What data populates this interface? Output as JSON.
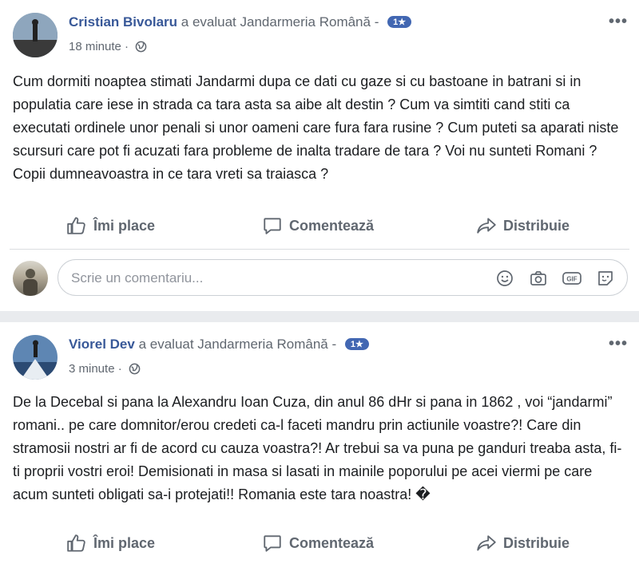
{
  "posts": [
    {
      "author": "Cristian Bivolaru",
      "action": "a evaluat Jandarmeria Română -",
      "rating": "1★",
      "time": "18 minute",
      "text": "Cum dormiti noaptea stimati Jandarmi dupa ce dati cu gaze si cu bastoane in batrani si in populatia care iese in strada ca tara asta sa aibe alt destin ? Cum va simtiti cand stiti ca executati ordinele unor penali si unor oameni care fura fara rusine ? Cum puteti sa aparati niste scursuri care pot fi acuzati fara probleme de inalta tradare de tara ? Voi nu sunteti Romani ? Copii dumneavoastra in ce tara vreti sa traiasca ?"
    },
    {
      "author": "Viorel Dev",
      "action": "a evaluat Jandarmeria Română -",
      "rating": "1★",
      "time": "3 minute",
      "text": "De la Decebal si pana la Alexandru Ioan Cuza, din anul 86 dHr si pana in 1862 , voi “jandarmi” romani.. pe care domnitor/erou credeti ca-l faceti mandru prin actiunile voastre?! Care din stramosii nostri ar fi de acord cu cauza voastra?! Ar trebui sa va puna pe ganduri treaba asta, fi-ti proprii vostri eroi! Demisionati in masa si lasati in mainile poporului pe acei viermi pe care acum sunteti obligati sa-i protejati!! Romania este tara noastra! �"
    }
  ],
  "actions": {
    "like": "Îmi place",
    "comment": "Comentează",
    "share": "Distribuie"
  },
  "comment_box": {
    "placeholder": "Scrie un comentariu..."
  },
  "more_label": "•••",
  "icons": [
    "thumbs-up-icon",
    "comment-bubble-icon",
    "share-arrow-icon",
    "globe-icon",
    "emoji-icon",
    "camera-icon",
    "gif-icon",
    "sticker-icon",
    "more-options-icon"
  ]
}
